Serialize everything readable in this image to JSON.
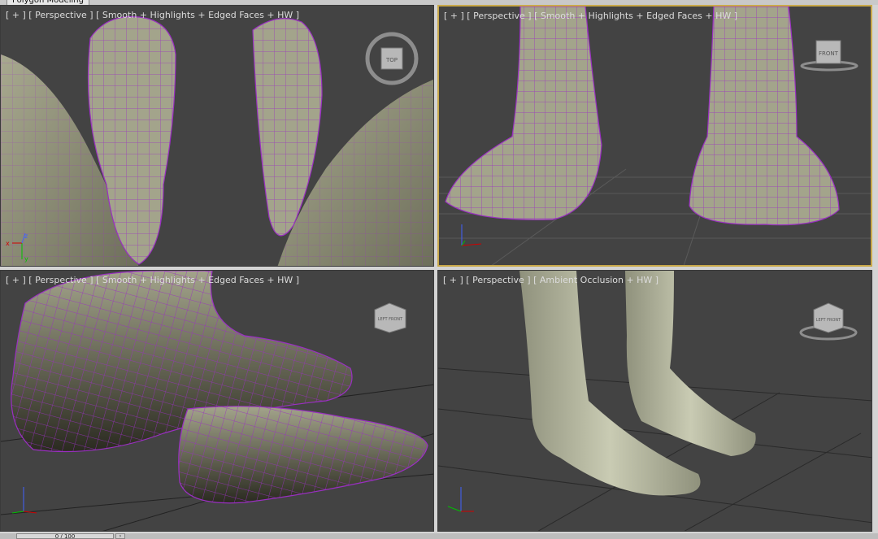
{
  "window": {
    "title": "Polygon Modeling"
  },
  "viewports": [
    {
      "label": "[ + ] [ Perspective ] [ Smooth + Highlights + Edged Faces + HW ]",
      "cube_face": "TOP"
    },
    {
      "label": "[ + ] [ Perspective ] [ Smooth + Highlights + Edged Faces + HW ]",
      "cube_face": "FRONT"
    },
    {
      "label": "[ + ] [ Perspective ] [ Smooth + Highlights + Edged Faces + HW ]",
      "cube_face": "LEFT FRONT"
    },
    {
      "label": "[ + ] [ Perspective ] [ Ambient Occlusion + HW ]",
      "cube_face": "LEFT FRONT"
    }
  ],
  "axes": {
    "x": "x",
    "y": "y",
    "z": "z"
  },
  "timeline": {
    "frame_readout": "0 / 100"
  },
  "colors": {
    "mesh_wire": "#9a2fc2",
    "skin": "#9a9b84",
    "active_border": "#c9a94a",
    "viewport_bg": "#434343"
  },
  "icons": {
    "nav_cube": "viewcube-icon",
    "axis_tripod": "axis-tripod-icon",
    "next_frame": "chevron-right-icon"
  }
}
